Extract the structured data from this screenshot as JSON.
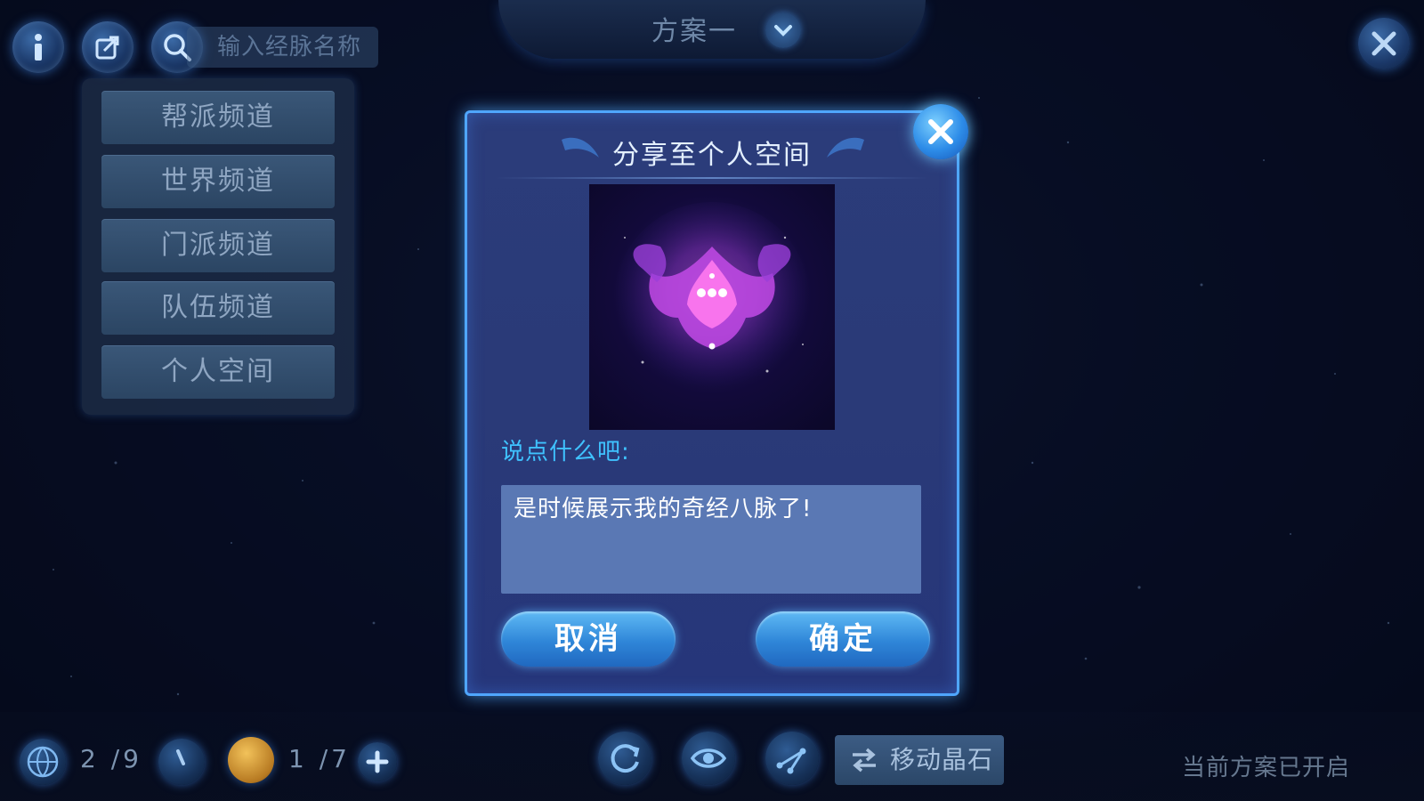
{
  "toolbar": {
    "search_placeholder": "输入经脉名称",
    "icons": [
      "info-icon",
      "share-icon",
      "search-icon"
    ]
  },
  "scheme": {
    "title": "方案一"
  },
  "share_panel": {
    "items": [
      {
        "label": "帮派频道"
      },
      {
        "label": "世界频道"
      },
      {
        "label": "门派频道"
      },
      {
        "label": "队伍频道"
      },
      {
        "label": "个人空间"
      }
    ]
  },
  "dialog": {
    "title": "分享至个人空间",
    "prompt_label": "说点什么吧:",
    "message": "是时候展示我的奇经八脉了!",
    "cancel_label": "取消",
    "confirm_label": "确定"
  },
  "bottom": {
    "points_counter": "2 /9",
    "crystal_counter": "1 /7",
    "move_crystal_label": "移动晶石",
    "status": "当前方案已开启"
  },
  "colors": {
    "dialog_border": "#4fa6ff",
    "dialog_bg": "#2a3a78",
    "prompt_text": "#3fc2ff",
    "button_blue": "#2f86d8"
  }
}
